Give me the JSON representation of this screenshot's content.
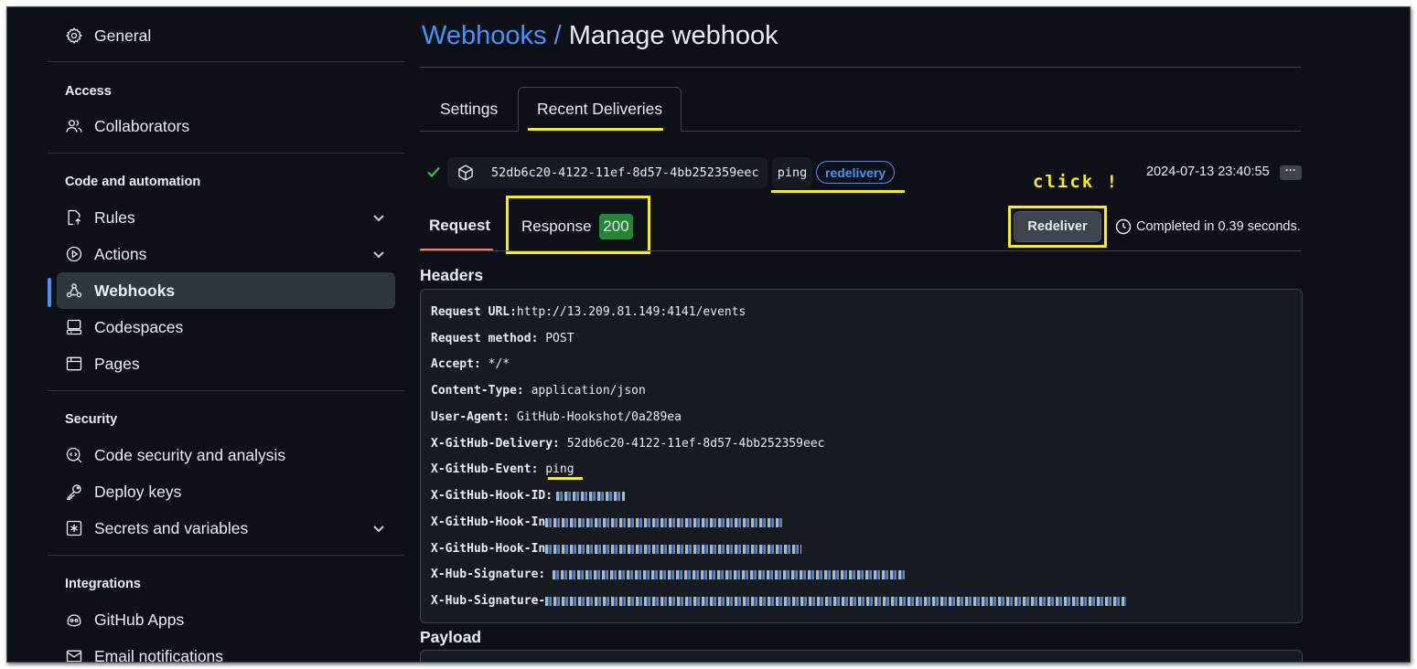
{
  "sidebar": {
    "general": "General",
    "sections": {
      "access": "Access",
      "code_automation": "Code and automation",
      "security": "Security",
      "integrations": "Integrations"
    },
    "items": {
      "collaborators": "Collaborators",
      "rules": "Rules",
      "actions": "Actions",
      "webhooks": "Webhooks",
      "codespaces": "Codespaces",
      "pages": "Pages",
      "code_security": "Code security and analysis",
      "deploy_keys": "Deploy keys",
      "secrets": "Secrets and variables",
      "github_apps": "GitHub Apps",
      "email_notifications": "Email notifications"
    },
    "active_item": "webhooks"
  },
  "header": {
    "breadcrumb_link": "Webhooks",
    "separator": "/",
    "title": "Manage webhook"
  },
  "tabs": {
    "settings": "Settings",
    "recent_deliveries": "Recent Deliveries",
    "selected": "recent_deliveries"
  },
  "delivery": {
    "guid": "52db6c20-4122-11ef-8d57-4bb252359eec",
    "event": "ping",
    "badge": "redelivery",
    "timestamp": "2024-07-13 23:40:55",
    "more": "···"
  },
  "detail": {
    "request_tab": "Request",
    "response_tab": "Response",
    "response_code": "200",
    "redeliver_button": "Redeliver",
    "completed_text": "Completed in 0.39 seconds.",
    "annotation": "click !"
  },
  "headers_section": {
    "title": "Headers",
    "rows": [
      {
        "key": "Request URL:",
        "value": "http://13.209.81.149:4141/events"
      },
      {
        "key": "Request method:",
        "value": " POST"
      },
      {
        "key": "Accept:",
        "value": " */*"
      },
      {
        "key": "Content-Type:",
        "value": " application/json"
      },
      {
        "key": "User-Agent:",
        "value": " GitHub-Hookshot/0a289ea"
      },
      {
        "key": "X-GitHub-Delivery:",
        "value": " 52db6c20-4122-11ef-8d57-4bb252359eec"
      },
      {
        "key": "X-GitHub-Event:",
        "value": " ping"
      },
      {
        "key": "X-GitHub-Hook-ID:",
        "value": ""
      },
      {
        "key": "X-GitHub-Hook-In",
        "value": ""
      },
      {
        "key": "X-GitHub-Hook-In",
        "value": ""
      },
      {
        "key": "X-Hub-Signature:",
        "value": ""
      },
      {
        "key": "X-Hub-Signature-",
        "value": ""
      }
    ]
  },
  "payload_section": {
    "title": "Payload"
  },
  "colors": {
    "background": "#0d1117",
    "accent_blue": "#4493f8",
    "success_green": "#3fb950",
    "highlight_yellow": "#ffee00"
  }
}
